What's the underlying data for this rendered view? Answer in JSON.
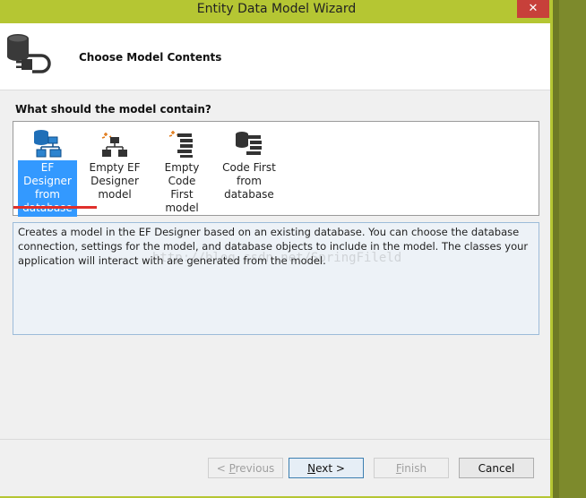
{
  "window": {
    "title": "Entity Data Model Wizard",
    "close_glyph": "✕",
    "accent_color": "#b5c633",
    "close_color": "#c7403a"
  },
  "header": {
    "title": "Choose Model Contents",
    "icon": "database-plug-icon"
  },
  "question": "What should the model contain?",
  "options": [
    {
      "label": "EF Designer\nfrom\ndatabase",
      "icon": "ef-designer-database-icon",
      "selected": true
    },
    {
      "label": "Empty EF\nDesigner\nmodel",
      "icon": "empty-designer-icon",
      "selected": false
    },
    {
      "label": "Empty Code\nFirst model",
      "icon": "empty-code-first-icon",
      "selected": false
    },
    {
      "label": "Code First\nfrom\ndatabase",
      "icon": "code-first-database-icon",
      "selected": false
    }
  ],
  "description": "Creates a model in the EF Designer based on an existing database. You can choose the database connection, settings for the model, and database objects to include in the model. The classes your application will interact with are generated from the model.",
  "watermark": "http://blog.csdn.net/SpringFileld",
  "buttons": {
    "previous": {
      "prefix": "< ",
      "mnemonic": "P",
      "rest": "revious",
      "enabled": false
    },
    "next": {
      "mnemonic": "N",
      "rest": "ext >",
      "enabled": true
    },
    "finish": {
      "mnemonic": "F",
      "rest": "inish",
      "enabled": false
    },
    "cancel": {
      "label": "Cancel",
      "enabled": true
    }
  }
}
